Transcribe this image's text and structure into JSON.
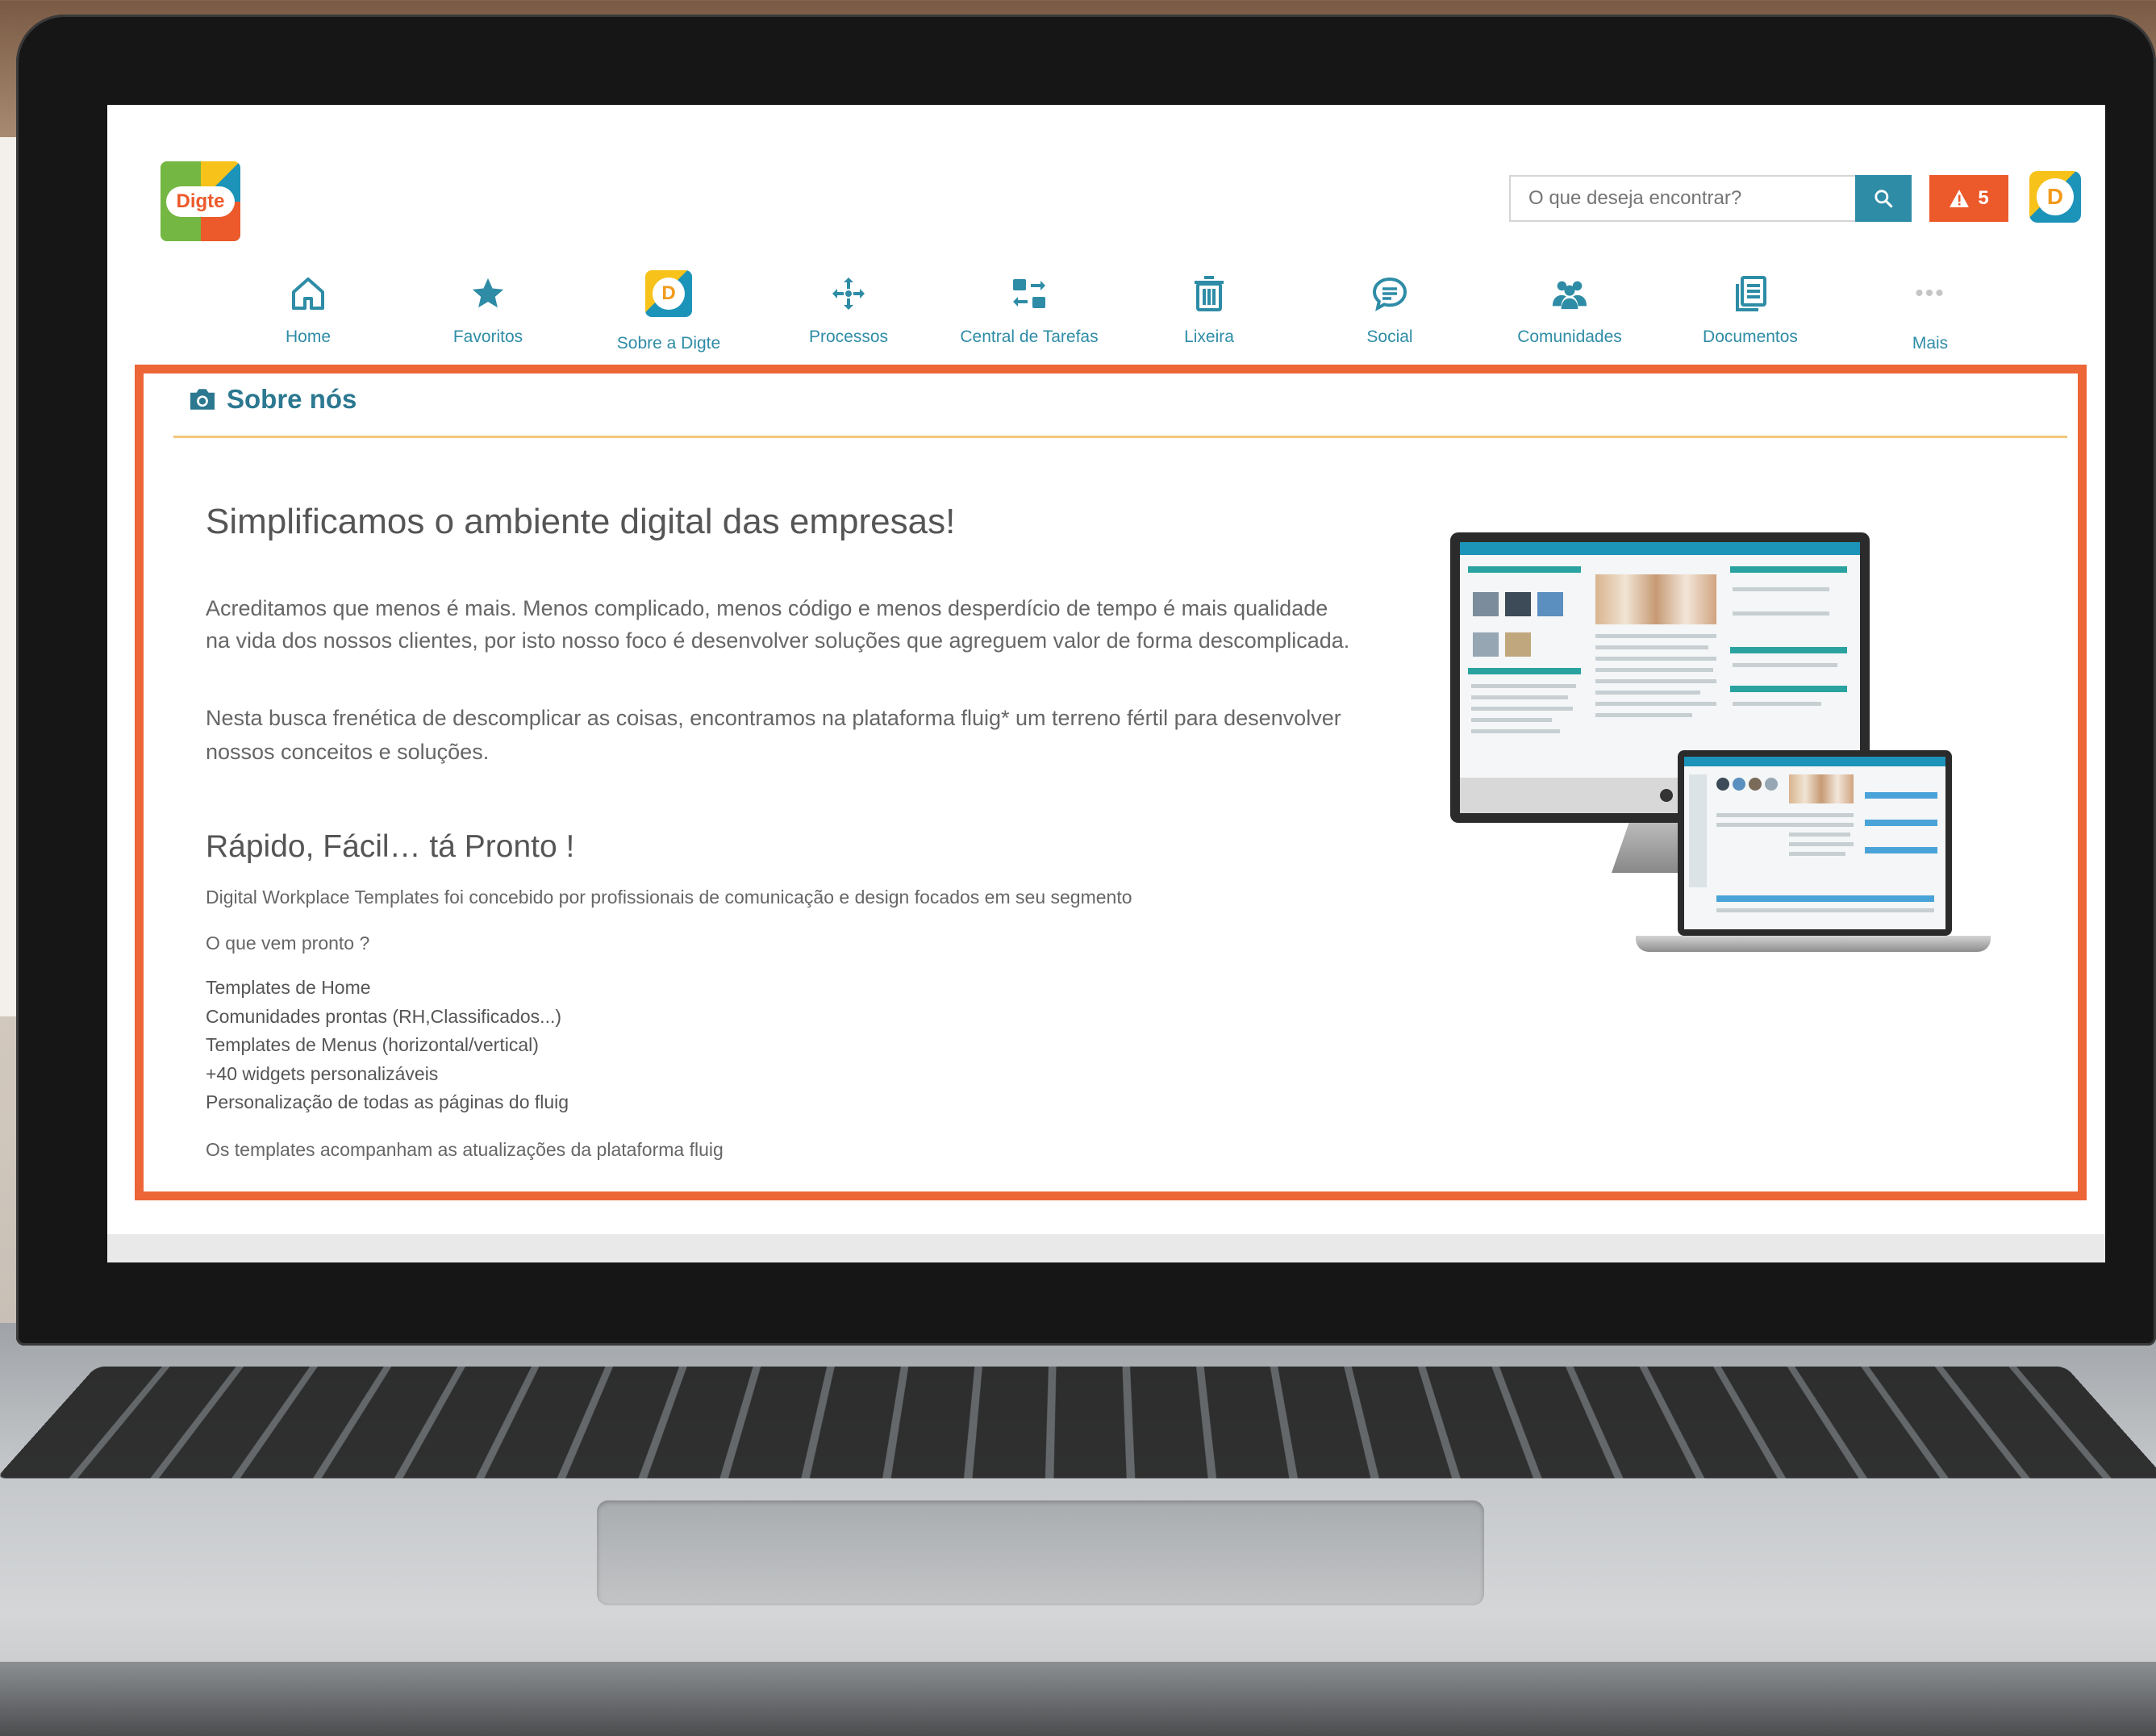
{
  "header": {
    "logo_text": "Digte",
    "search": {
      "placeholder": "O que deseja encontrar?"
    },
    "alerts": {
      "count": "5"
    },
    "avatar_letter": "D",
    "colors": {
      "teal": "#2e8ca6",
      "orange": "#ec5a2b",
      "yellow": "#f7c21a",
      "green": "#74b743"
    }
  },
  "nav": {
    "items": [
      {
        "label": "Home",
        "icon": "home-icon"
      },
      {
        "label": "Favoritos",
        "icon": "star-icon"
      },
      {
        "label": "Sobre a Digte",
        "icon": "digte-d-icon",
        "letter": "D"
      },
      {
        "label": "Processos",
        "icon": "process-arrows-icon"
      },
      {
        "label": "Central de Tarefas",
        "icon": "tasks-swap-icon"
      },
      {
        "label": "Lixeira",
        "icon": "trash-icon"
      },
      {
        "label": "Social",
        "icon": "chat-bubble-icon"
      },
      {
        "label": "Comunidades",
        "icon": "people-icon"
      },
      {
        "label": "Documentos",
        "icon": "documents-icon"
      },
      {
        "label": "Mais",
        "icon": "more-dots-icon"
      }
    ]
  },
  "section": {
    "title": "Sobre nós",
    "highlight_color": "#ec6637"
  },
  "content": {
    "heading": "Simplificamos o ambiente digital das empresas!",
    "paragraph1": "Acreditamos que menos é mais. Menos complicado, menos código e menos desperdício de tempo é mais qualidade na vida dos nossos clientes, por isto nosso foco é desenvolver soluções que agreguem valor de forma descomplicada.",
    "paragraph2": "Nesta busca frenética de descomplicar as coisas, encontramos na plataforma fluig* um terreno fértil para desenvolver nossos conceitos e soluções.",
    "subheading": "Rápido, Fácil… tá Pronto !",
    "line1": "Digital Workplace Templates foi concebido por profissionais de comunicação e design focados em seu segmento",
    "line2": "O que vem pronto ?",
    "list": [
      "Templates de Home",
      "Comunidades prontas (RH,Classificados...)",
      "Templates de Menus (horizontal/vertical)",
      "+40 widgets personalizáveis",
      "Personalização de todas as páginas do fluig"
    ],
    "footer_line": "Os templates acompanham as atualizações da plataforma fluig"
  }
}
